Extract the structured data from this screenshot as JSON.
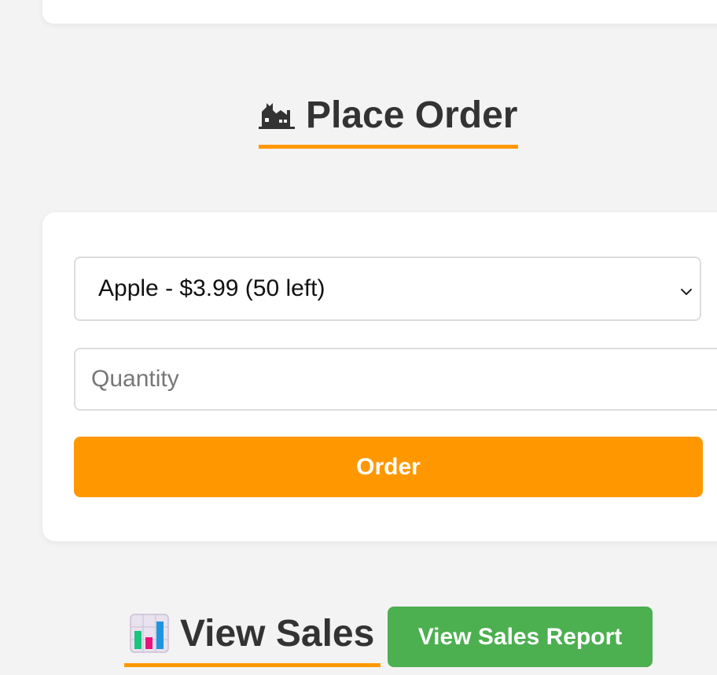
{
  "place_order": {
    "title": "Place Order",
    "icon": "cat-icon",
    "product_select": {
      "selected_option": "Apple - $3.99 (50 left)"
    },
    "quantity_input": {
      "value": "",
      "placeholder": "Quantity"
    },
    "order_button_label": "Order"
  },
  "view_sales": {
    "title": "View Sales",
    "icon": "bar-chart-icon",
    "report_button_label": "View Sales Report"
  },
  "colors": {
    "accent": "#ff9800",
    "report_button": "#4caf50",
    "background": "#f3f3f3",
    "card": "#ffffff",
    "heading_text": "#333333"
  }
}
